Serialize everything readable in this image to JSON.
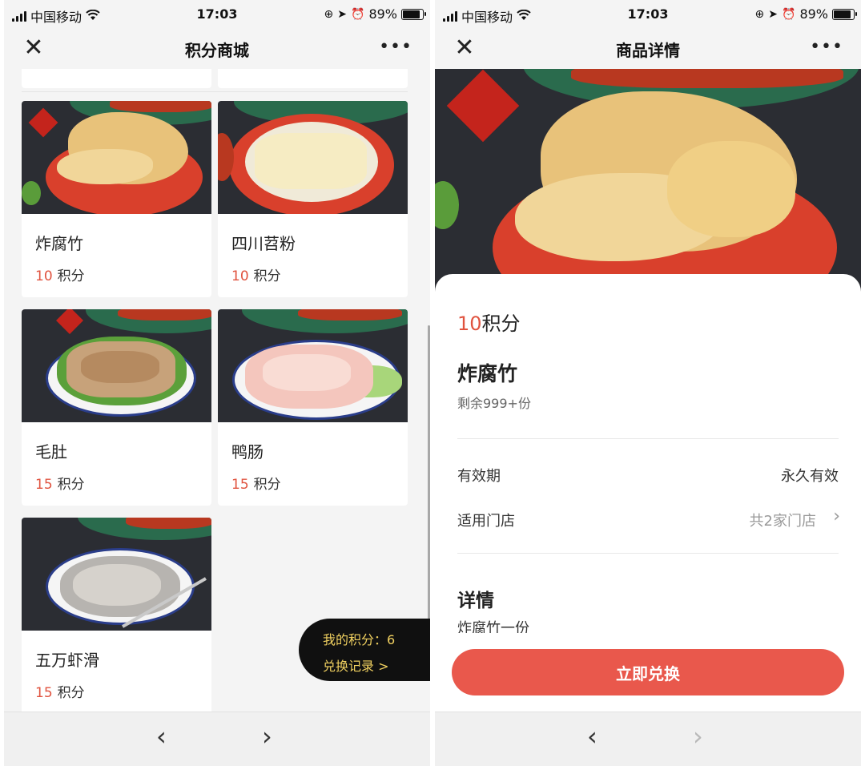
{
  "status_bar": {
    "carrier": "中国移动",
    "time": "17:03",
    "battery": "89%"
  },
  "left": {
    "nav_title": "积分商城",
    "items": [
      {
        "name": "炸腐竹",
        "points": "10",
        "unit": "积分"
      },
      {
        "name": "四川苕粉",
        "points": "10",
        "unit": "积分"
      },
      {
        "name": "毛肚",
        "points": "15",
        "unit": "积分"
      },
      {
        "name": "鸭肠",
        "points": "15",
        "unit": "积分"
      },
      {
        "name": "五万虾滑",
        "points": "15",
        "unit": "积分"
      }
    ],
    "points_float": {
      "my_points": "我的积分：6",
      "records": "兑换记录 >"
    }
  },
  "right": {
    "nav_title": "商品详情",
    "price_num": "10",
    "price_unit": "积分",
    "name": "炸腐竹",
    "stock": "剩余999+份",
    "validity_label": "有效期",
    "validity_value": "永久有效",
    "stores_label": "适用门店",
    "stores_value": "共2家门店",
    "detail_heading": "详情",
    "detail_text": "炸腐竹一份",
    "redeem_button": "立即兑换"
  },
  "icons": {
    "close": "close-icon",
    "more": "more-icon",
    "back": "chevron-left-icon",
    "forward": "chevron-right-icon"
  },
  "colors": {
    "accent": "#e0533f",
    "button": "#e9584c",
    "float_text": "#f0d060"
  }
}
